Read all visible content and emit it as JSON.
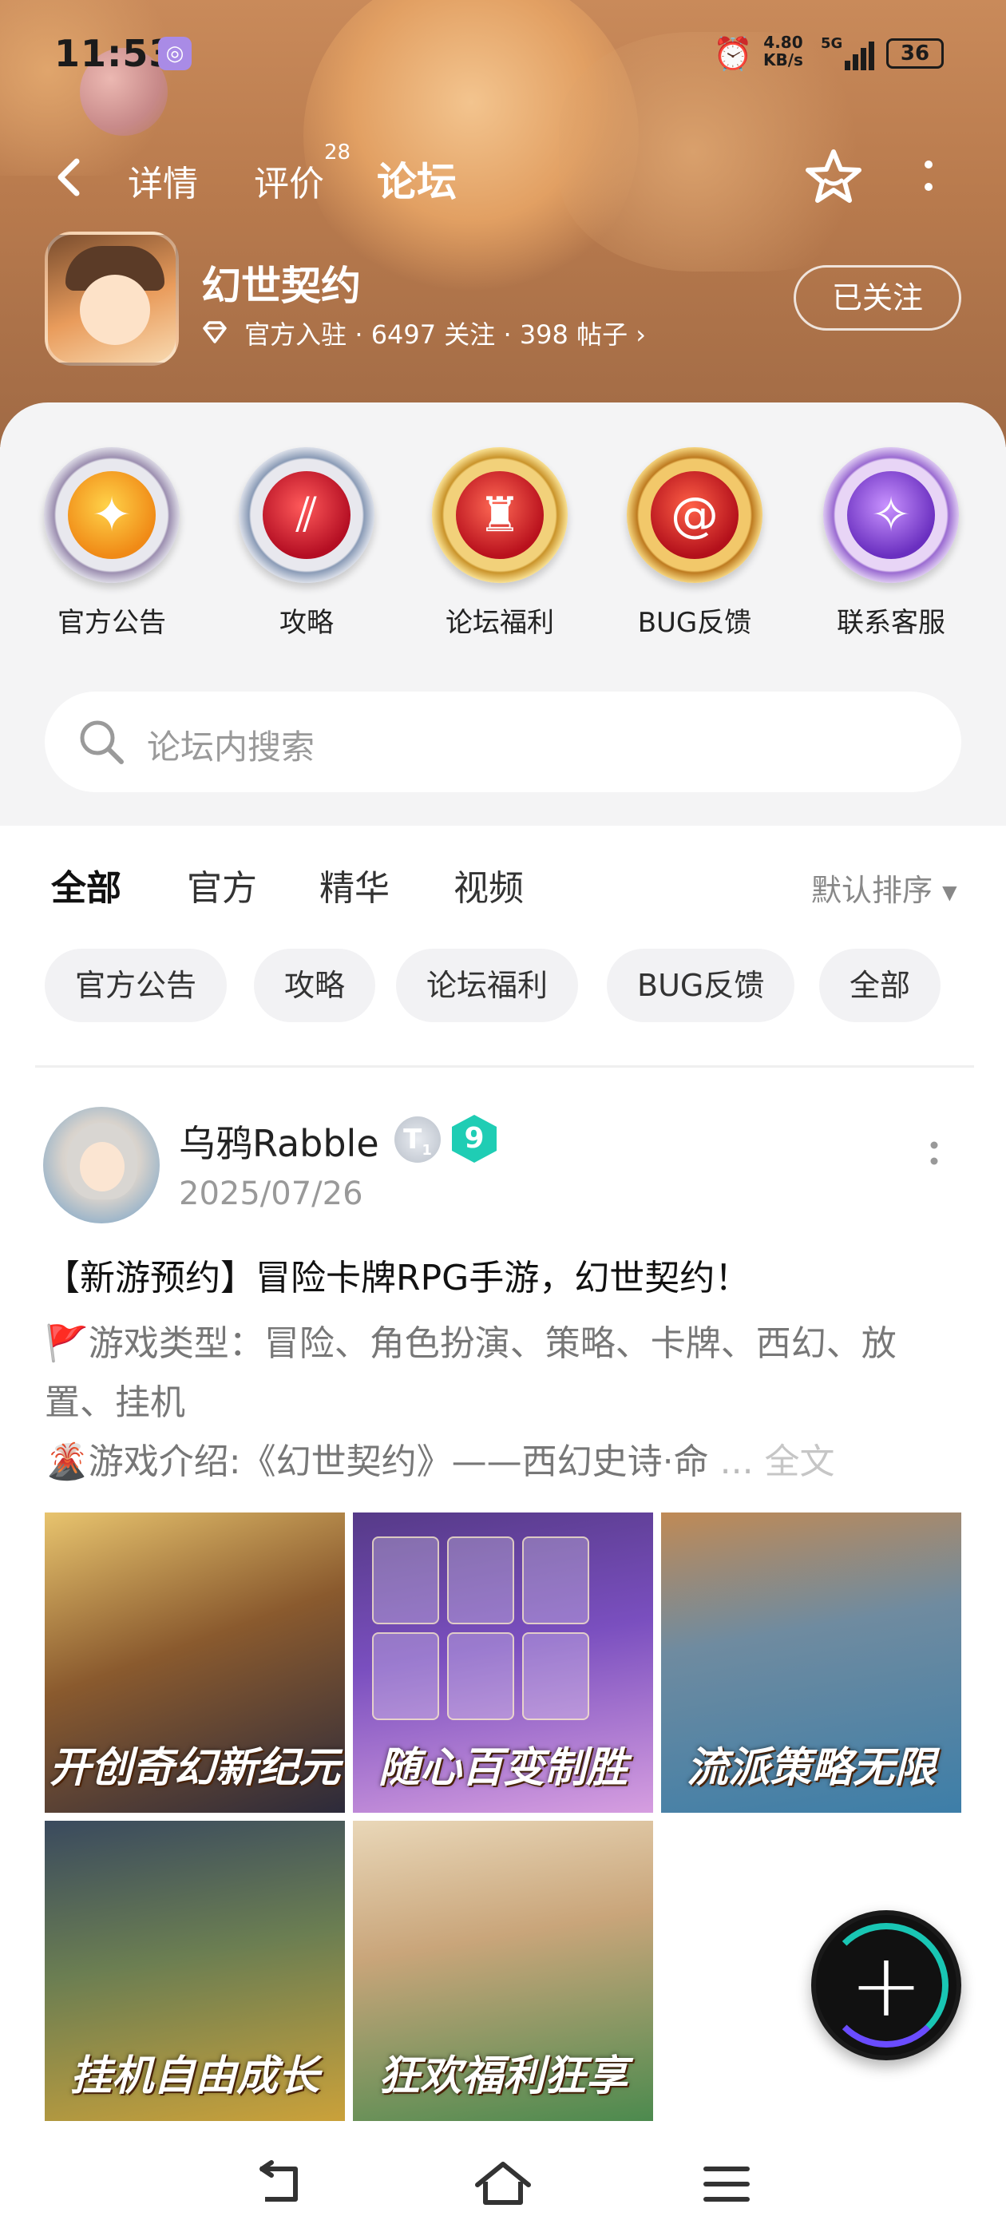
{
  "status_bar": {
    "time": "11:53",
    "network_speed_value": "4.80",
    "network_speed_unit": "KB/s",
    "network_type": "5G",
    "battery": "36"
  },
  "nav": {
    "tabs": [
      {
        "label": "详情"
      },
      {
        "label": "评价",
        "badge": "28"
      },
      {
        "label": "论坛"
      }
    ],
    "active_tab": "论坛"
  },
  "game": {
    "name": "幻世契约",
    "meta": "官方入驻 · 6497 关注 · 398 帖子",
    "meta_arrow": "›",
    "follow_button": "已关注"
  },
  "categories": [
    {
      "label": "官方公告",
      "icon": "megaphone-badge-icon"
    },
    {
      "label": "攻略",
      "icon": "claw-badge-icon"
    },
    {
      "label": "论坛福利",
      "icon": "hooded-figure-badge-icon"
    },
    {
      "label": "BUG反馈",
      "icon": "spiral-badge-icon"
    },
    {
      "label": "联系客服",
      "icon": "hands-badge-icon"
    }
  ],
  "search": {
    "placeholder": "论坛内搜索"
  },
  "feed_tabs": [
    {
      "label": "全部"
    },
    {
      "label": "官方"
    },
    {
      "label": "精华"
    },
    {
      "label": "视频"
    }
  ],
  "feed_active_tab": "全部",
  "sort_label": "默认排序",
  "chips": [
    {
      "label": "官方公告"
    },
    {
      "label": "攻略"
    },
    {
      "label": "论坛福利"
    },
    {
      "label": "BUG反馈"
    },
    {
      "label": "全部"
    }
  ],
  "post": {
    "author": "乌鸦Rabble",
    "badge_t": "T",
    "badge_t_sub": "1",
    "level": "9",
    "date": "2025/07/26",
    "title": "【新游预约】冒险卡牌RPG手游，幻世契约！",
    "line1_prefix": "🚩",
    "line1": "游戏类型：冒险、角色扮演、策略、卡牌、西幻、放置、挂机",
    "line2_prefix": "🌋",
    "line2": "游戏介绍:《幻世契约》——西幻史诗·命",
    "ellipsis": " ... ",
    "full_text": "全文",
    "images": [
      {
        "caption": "开创奇幻新纪元"
      },
      {
        "caption": "随心百变制胜"
      },
      {
        "caption": "流派策略无限"
      },
      {
        "caption": "挂机自由成长"
      },
      {
        "caption": "狂欢福利狂享"
      }
    ]
  },
  "colors": {
    "accent": "#17c7b6",
    "banner": "#b87a4d",
    "text_muted": "#999999"
  }
}
